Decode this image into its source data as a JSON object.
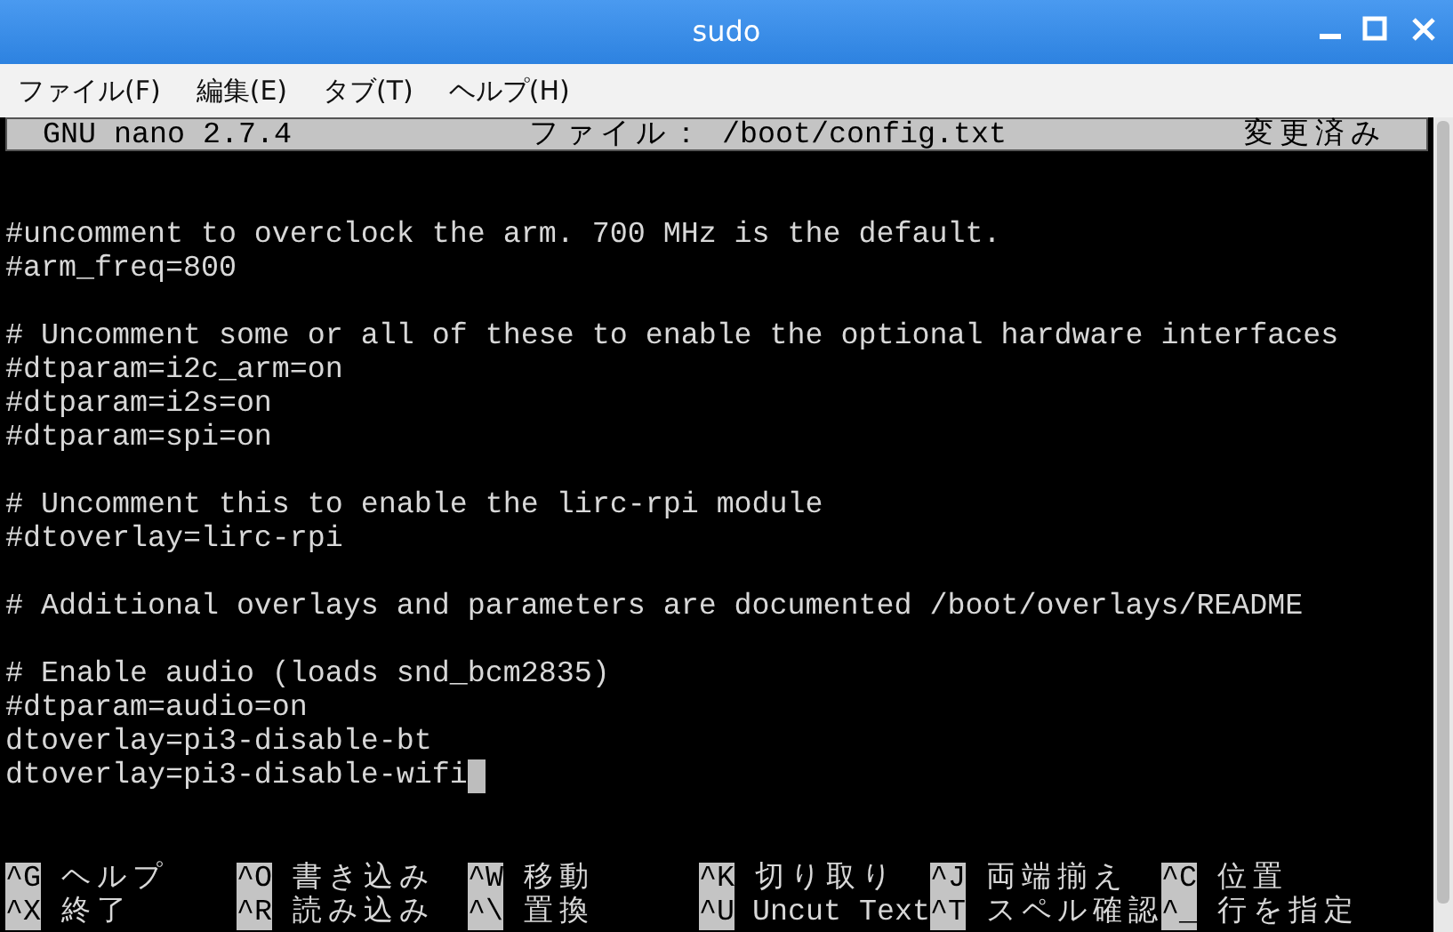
{
  "window": {
    "title": "sudo"
  },
  "menu": [
    "ファイル(F)",
    "編集(E)",
    "タブ(T)",
    "ヘルプ(H)"
  ],
  "nano_header": {
    "version": "GNU nano 2.7.4",
    "file": "ファイル： /boot/config.txt",
    "status": "変更済み"
  },
  "editor": {
    "paragraphs": [
      [
        "#uncomment to overclock the arm. 700 MHz is the default.",
        "#arm_freq=800"
      ],
      [
        "# Uncomment some or all of these to enable the optional hardware interfaces",
        "#dtparam=i2c_arm=on",
        "#dtparam=i2s=on",
        "#dtparam=spi=on"
      ],
      [
        "# Uncomment this to enable the lirc-rpi module",
        "#dtoverlay=lirc-rpi"
      ],
      [
        "# Additional overlays and parameters are documented /boot/overlays/README"
      ],
      [
        "# Enable audio (loads snd_bcm2835)",
        "#dtparam=audio=on",
        "dtoverlay=pi3-disable-bt",
        "dtoverlay=pi3-disable-wifi"
      ]
    ],
    "cursor_at_end": true
  },
  "shortcuts": [
    [
      {
        "key": "^G",
        "label": "ヘルプ"
      },
      {
        "key": "^O",
        "label": "書き込み"
      },
      {
        "key": "^W",
        "label": "移動"
      },
      {
        "key": "^K",
        "label": "切り取り"
      },
      {
        "key": "^J",
        "label": "両端揃え"
      },
      {
        "key": "^C",
        "label": "位置"
      }
    ],
    [
      {
        "key": "^X",
        "label": "終了"
      },
      {
        "key": "^R",
        "label": "読み込み"
      },
      {
        "key": "^\\",
        "label": "置換"
      },
      {
        "key": "^U",
        "label": "Uncut Text"
      },
      {
        "key": "^T",
        "label": "スペル確認"
      },
      {
        "key": "^_",
        "label": "行を指定"
      }
    ]
  ]
}
